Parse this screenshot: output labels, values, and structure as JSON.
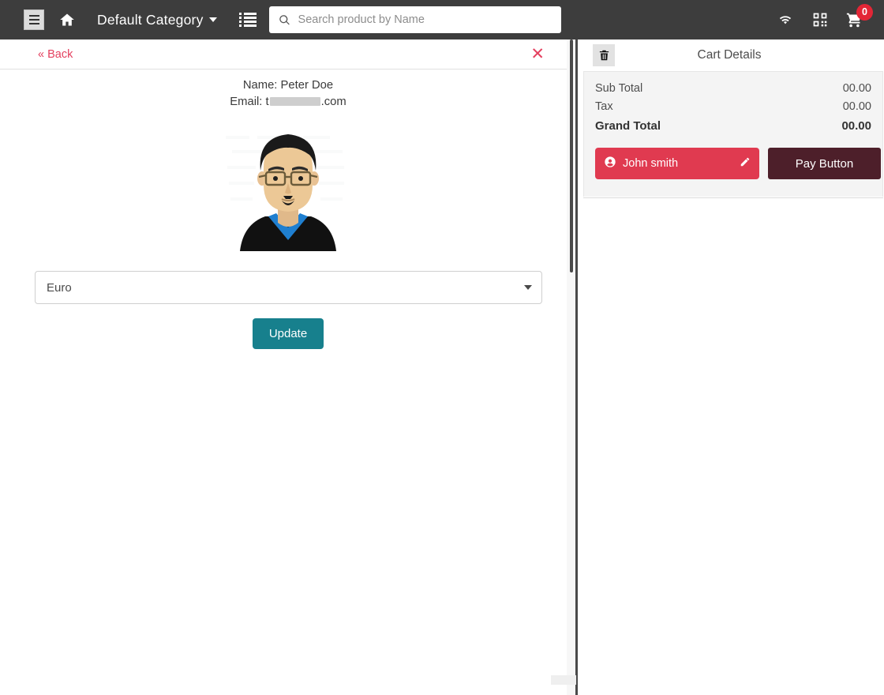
{
  "navbar": {
    "menu_icon": "hamburger-icon",
    "home_icon": "home-icon",
    "category_label": "Default Category",
    "list_view_icon": "list-view-icon",
    "search": {
      "placeholder": "Search product by Name",
      "value": "",
      "icon": "search-icon"
    },
    "wifi_icon": "wifi-icon",
    "qr_icon": "qr-code-icon",
    "cart_icon": "shopping-cart-icon",
    "cart_count": "0",
    "background": "#3d3d3d",
    "badge_color": "#e32636"
  },
  "customer_panel": {
    "back_label": "« Back",
    "close_icon": "close-icon",
    "name_line": "Name: Peter Doe",
    "email_prefix": "Email: t",
    "email_suffix": ".com",
    "avatar": "user-avatar-illustration",
    "currency_select": {
      "value": "Euro",
      "options": [
        "Euro"
      ]
    },
    "update_label": "Update",
    "link_color": "#e4405f",
    "update_color": "#17808d"
  },
  "cart": {
    "delete_icon": "trash-icon",
    "title": "Cart Details",
    "rows": [
      {
        "label": "Sub Total",
        "value": "00.00"
      },
      {
        "label": "Tax",
        "value": "00.00"
      }
    ],
    "grand_total": {
      "label": "Grand Total",
      "value": "00.00"
    },
    "customer_button": {
      "name": "John smith",
      "user_icon": "user-circle-icon",
      "edit_icon": "pencil-icon",
      "color": "#e03a50"
    },
    "pay_label": "Pay Button",
    "pay_color": "#4d1f2a"
  }
}
